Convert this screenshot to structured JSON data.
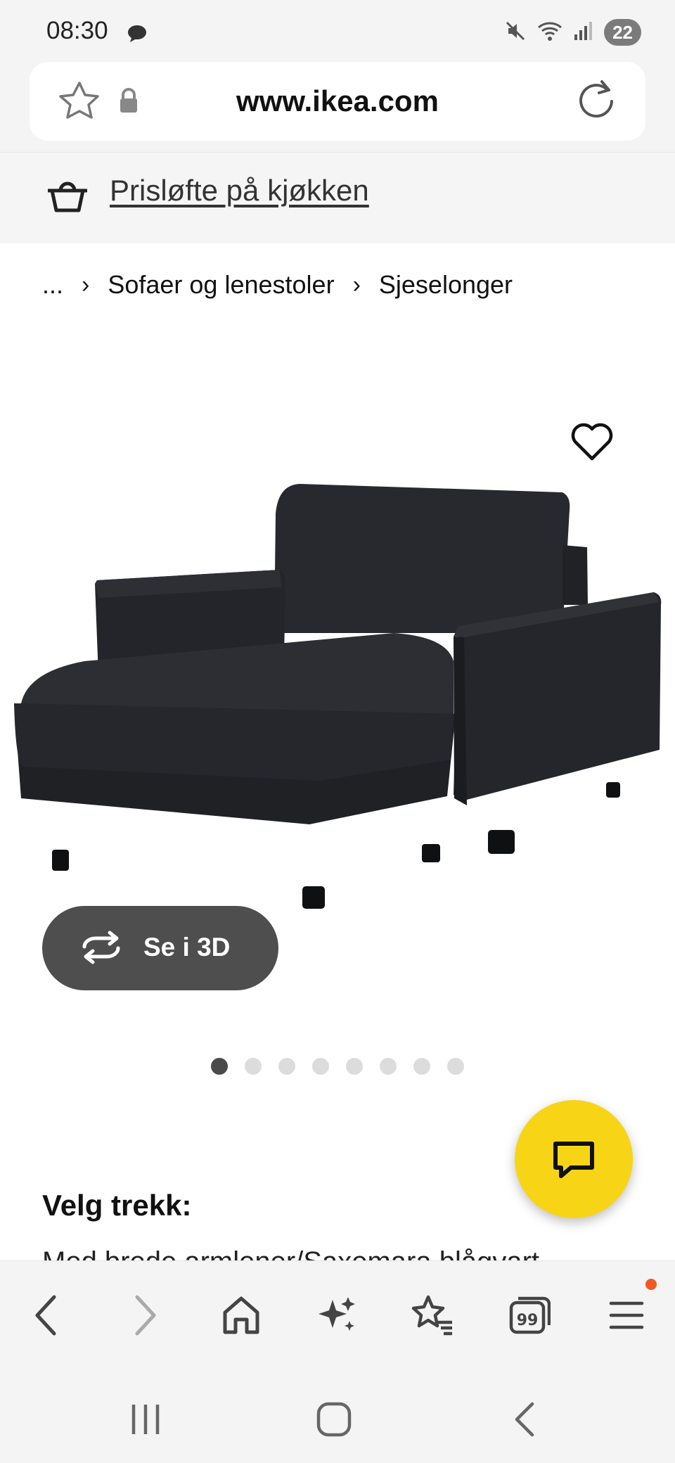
{
  "status_bar": {
    "time": "08:30",
    "battery": "22"
  },
  "url_bar": {
    "url": "www.ikea.com"
  },
  "promo": {
    "text": "Prisløfte på kjøkken"
  },
  "breadcrumb": {
    "items": [
      "...",
      "Sofaer og lenestoler",
      "Sjeselonger"
    ]
  },
  "product": {
    "view_3d_label": "Se i 3D",
    "image_count": 8,
    "active_image": 1
  },
  "options": {
    "cover_label": "Velg trekk:",
    "cover_value": "Med brede armlener/Saxemara blågvart"
  },
  "colors": {
    "accent_yellow": "#f7d516",
    "button_dark": "#4e4e4e",
    "notification": "#f05a22"
  },
  "icons": {
    "toolbar": [
      "back-arrow-icon",
      "forward-arrow-icon",
      "home-icon",
      "sparkle-icon",
      "bookmarks-icon",
      "tabs-icon",
      "menu-icon"
    ],
    "tabs_count": "99"
  }
}
